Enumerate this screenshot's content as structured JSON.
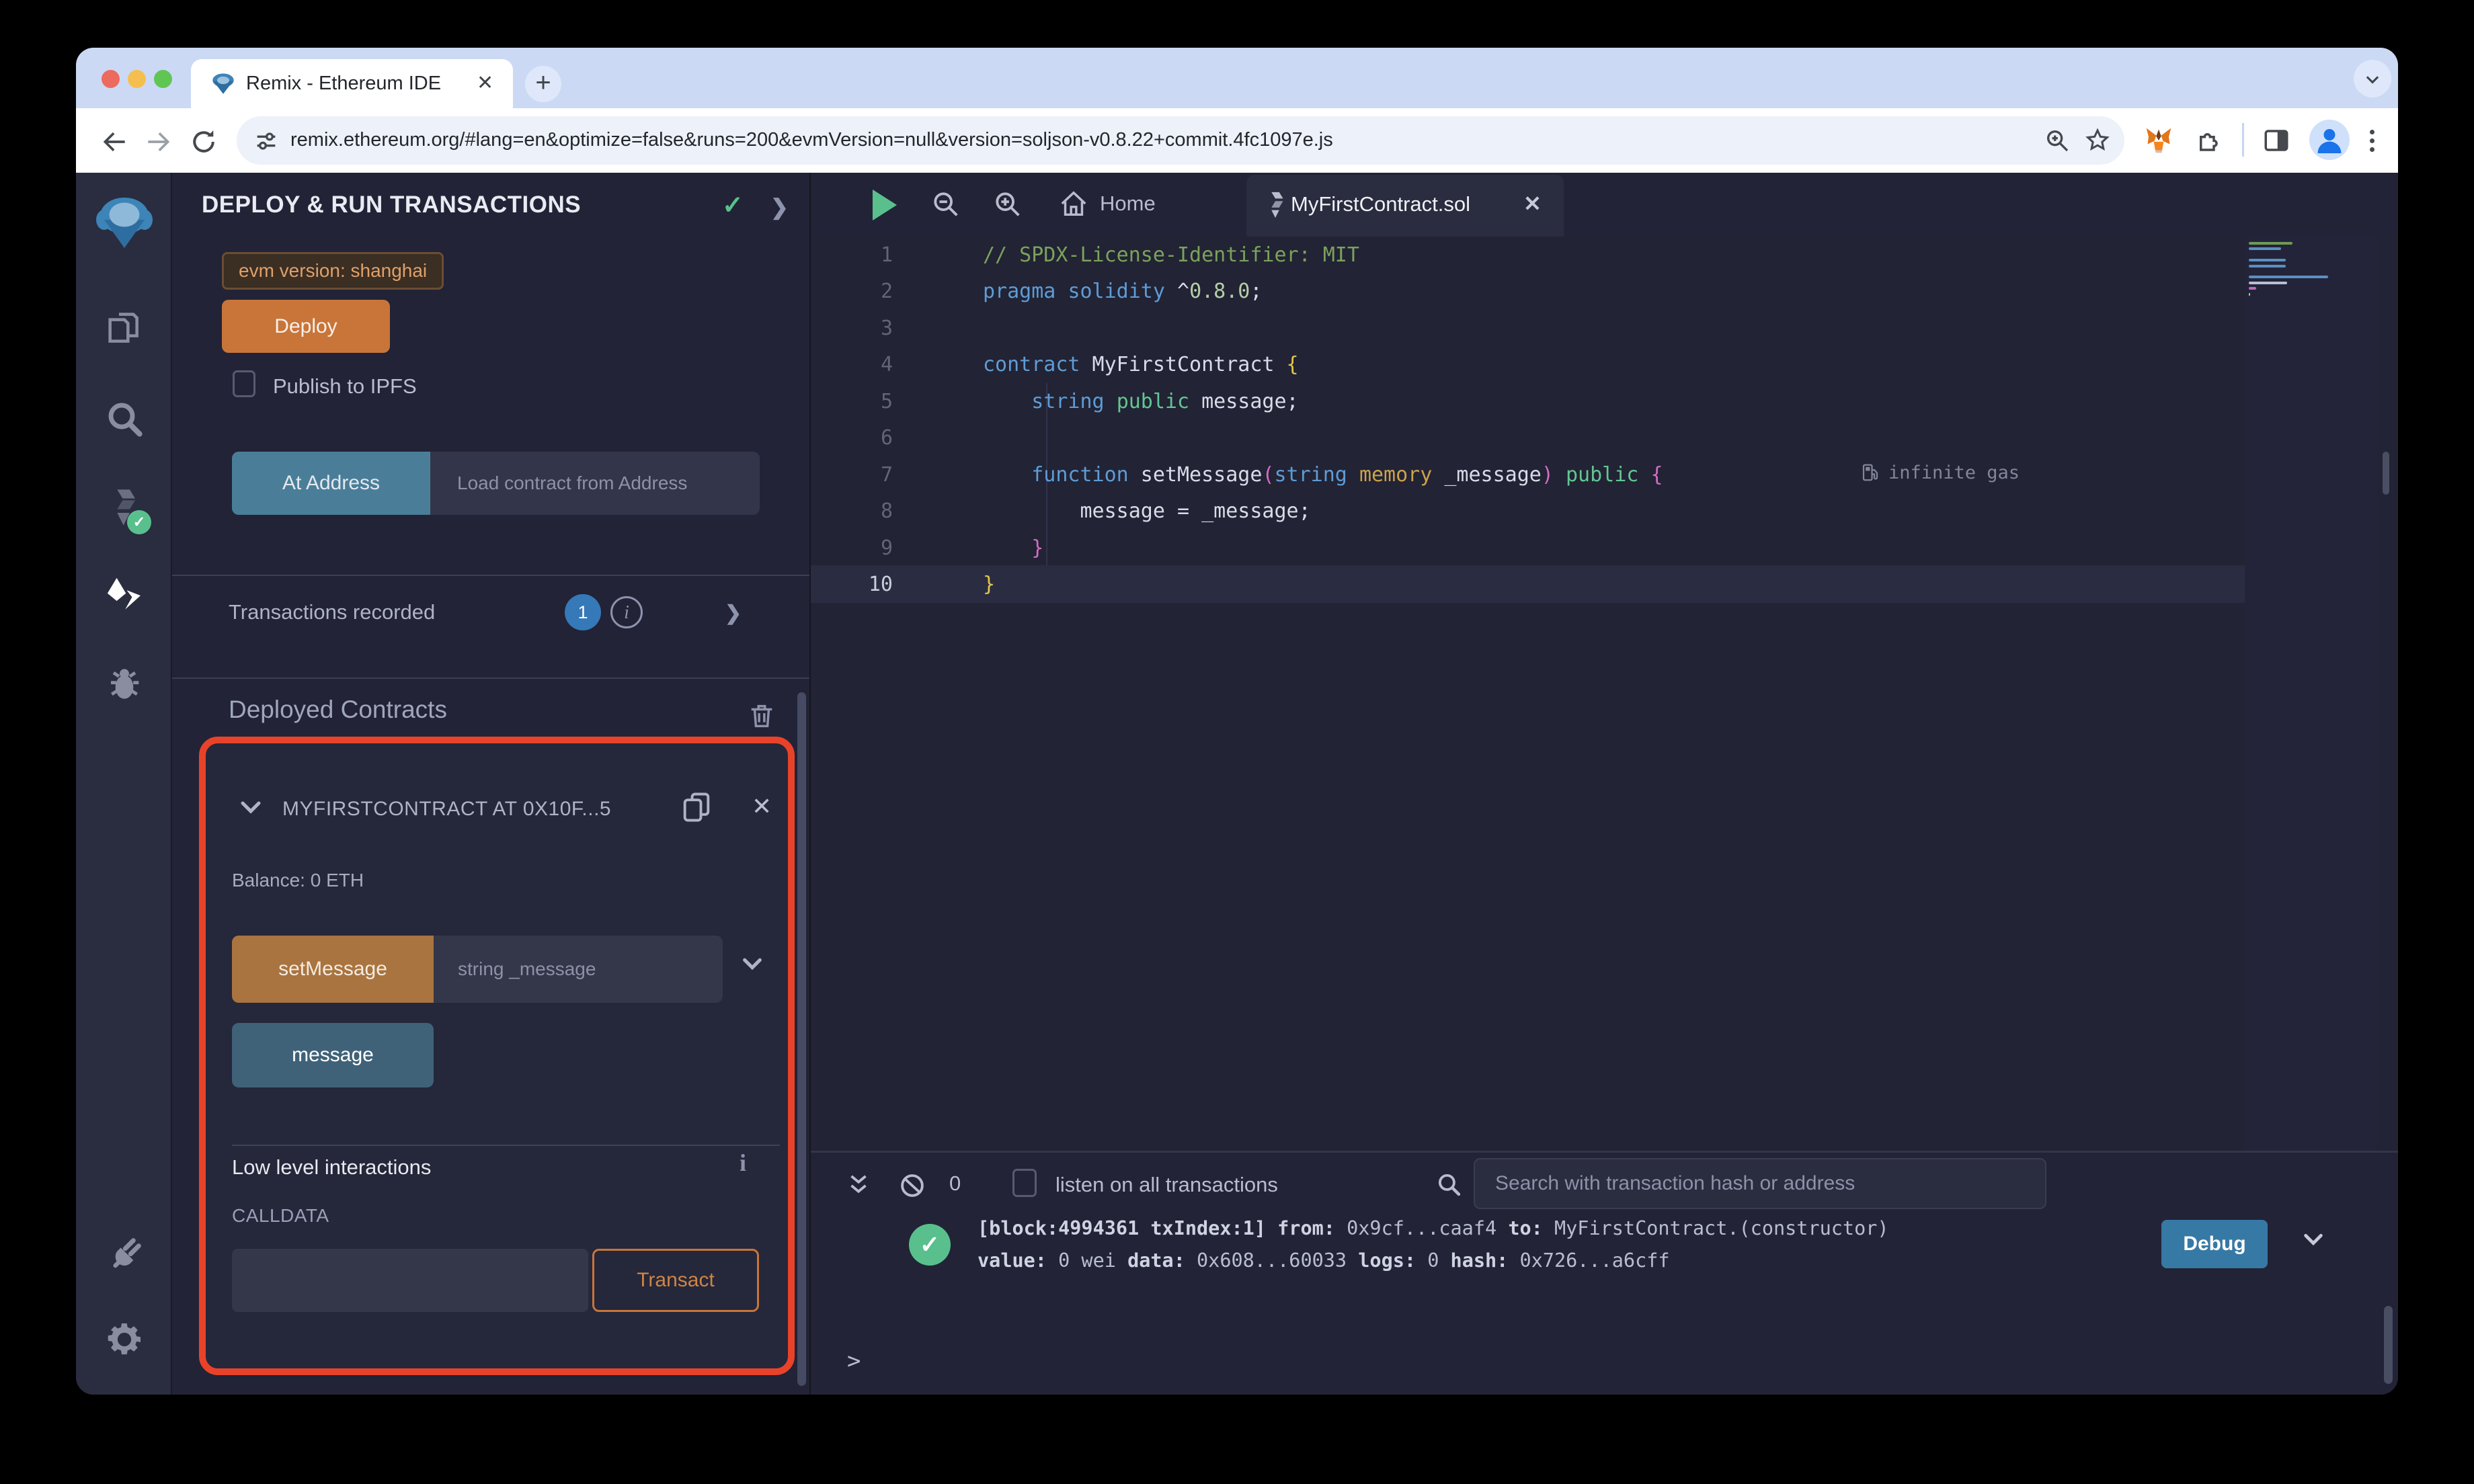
{
  "browser": {
    "tab_title": "Remix - Ethereum IDE",
    "new_tab_label": "+",
    "url": "remix.ethereum.org/#lang=en&optimize=false&runs=200&evmVersion=null&version=soljson-v0.8.22+commit.4fc1097e.js"
  },
  "run_panel": {
    "title": "DEPLOY & RUN TRANSACTIONS",
    "title_check": "✓",
    "evm_badge": "evm version: shanghai",
    "deploy_label": "Deploy",
    "publish_label": "Publish to IPFS",
    "at_address_label": "At Address",
    "at_address_placeholder": "Load contract from Address",
    "transactions_recorded_label": "Transactions recorded",
    "transactions_recorded_count": "1",
    "deployed_contracts_title": "Deployed Contracts",
    "contract": {
      "title": "MYFIRSTCONTRACT AT 0X10F...5",
      "balance": "Balance: 0 ETH",
      "set_message_label": "setMessage",
      "set_message_placeholder": "string _message",
      "message_label": "message",
      "low_level_title": "Low level interactions",
      "calldata_label": "CALLDATA",
      "transact_label": "Transact"
    }
  },
  "editor": {
    "home_label": "Home",
    "file_tab_label": "MyFirstContract.sol",
    "gas_label": "infinite gas",
    "code_lines": [
      [
        [
          "// SPDX-License-Identifier: MIT",
          "c"
        ]
      ],
      [
        [
          "pragma",
          "k"
        ],
        [
          " ",
          "t"
        ],
        [
          "solidity",
          "k"
        ],
        [
          " ^",
          "t"
        ],
        [
          "0.8.0",
          "n"
        ],
        [
          ";",
          "t"
        ]
      ],
      [],
      [
        [
          "contract",
          "k"
        ],
        [
          " MyFirstContract ",
          "t"
        ],
        [
          "{",
          "y"
        ]
      ],
      [
        [
          "    ",
          "t"
        ],
        [
          "string",
          "k"
        ],
        [
          " ",
          "t"
        ],
        [
          "public",
          "g"
        ],
        [
          " message;",
          "t"
        ]
      ],
      [],
      [
        [
          "    ",
          "t"
        ],
        [
          "function",
          "k"
        ],
        [
          " setMessage",
          "t"
        ],
        [
          "(",
          "p"
        ],
        [
          "string",
          "k"
        ],
        [
          " ",
          "t"
        ],
        [
          "memory",
          "o"
        ],
        [
          " _message",
          "t"
        ],
        [
          ")",
          "p"
        ],
        [
          " ",
          "t"
        ],
        [
          "public",
          "g"
        ],
        [
          " ",
          "t"
        ],
        [
          "{",
          "p"
        ]
      ],
      [
        [
          "        message = _message;",
          "t"
        ]
      ],
      [
        [
          "    ",
          "t"
        ],
        [
          "}",
          "p"
        ]
      ],
      [
        [
          "}",
          "y"
        ]
      ]
    ]
  },
  "terminal": {
    "count": "0",
    "listen_label": "listen on all transactions",
    "search_placeholder": "Search with transaction hash or address",
    "log_check": "✓",
    "log_lines": [
      [
        [
          "[block:4994361 txIndex:1]",
          "b"
        ],
        [
          "  ",
          "n"
        ],
        [
          "from:",
          "b"
        ],
        [
          " 0x9cf...caaf4 ",
          "n"
        ],
        [
          "to:",
          "b"
        ],
        [
          " MyFirstContract.(constructor) ",
          "n"
        ]
      ],
      [
        [
          "value:",
          "b"
        ],
        [
          " 0 wei ",
          "n"
        ],
        [
          "data:",
          "b"
        ],
        [
          " 0x608...60033 ",
          "n"
        ],
        [
          "logs:",
          "b"
        ],
        [
          " 0 ",
          "n"
        ],
        [
          "hash:",
          "b"
        ],
        [
          " 0x726...a6cff",
          "n"
        ]
      ]
    ],
    "debug_label": "Debug",
    "prompt": ">"
  },
  "colors": {
    "accent_orange": "#c97539",
    "annotation_red": "#e8432a",
    "success_green": "#59c08d",
    "debug_blue": "#3779a5",
    "count_badge_blue": "#3579b8",
    "at_address_teal": "#4a7e98"
  }
}
